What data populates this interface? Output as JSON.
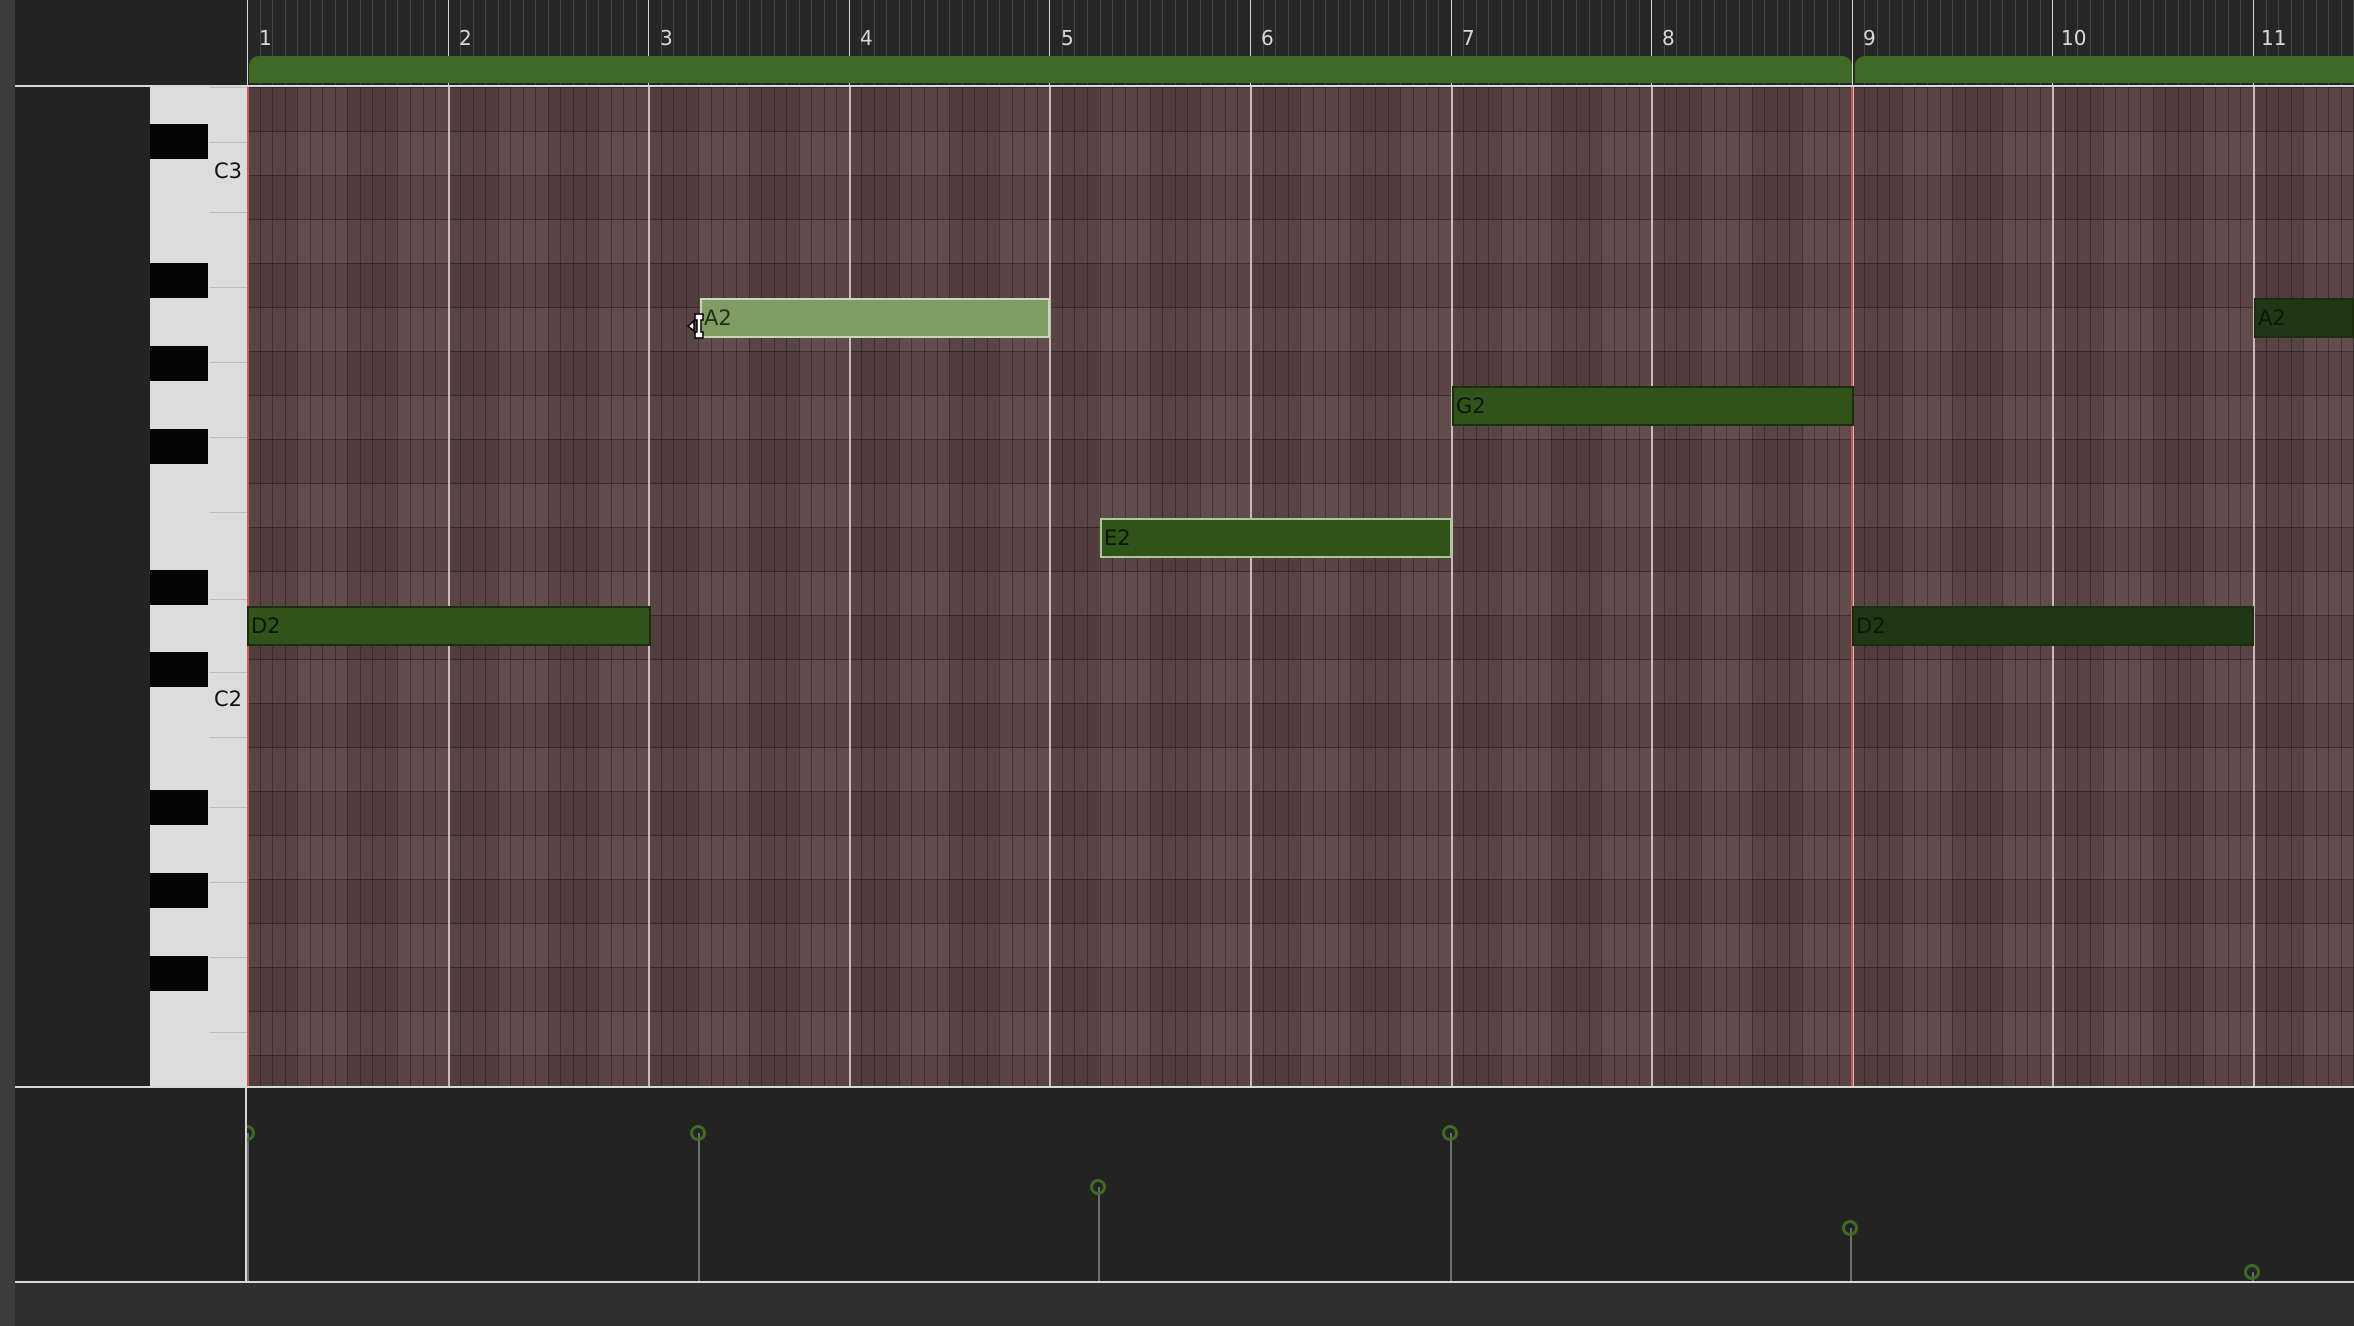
{
  "ruler": {
    "bars": [
      "1",
      "2",
      "3",
      "4",
      "5",
      "6",
      "7",
      "8",
      "9",
      "10",
      "11"
    ]
  },
  "piano": {
    "octave_labels": [
      "C3",
      "C2"
    ]
  },
  "notes": [
    {
      "label": "D2",
      "state": "normal"
    },
    {
      "label": "A2",
      "state": "selected"
    },
    {
      "label": "E2",
      "state": "normal"
    },
    {
      "label": "G2",
      "state": "normal"
    },
    {
      "label": "D2",
      "state": "dark"
    },
    {
      "label": "A2",
      "state": "dark"
    }
  ],
  "colors": {
    "note": "#2f5319",
    "note_selected": "#7f9c62",
    "region": "#3f6a25",
    "playhead": "#c85a5a",
    "grid": "#5a4544"
  },
  "icons": {
    "cursor": "resize-horizontal-cursor-icon"
  }
}
